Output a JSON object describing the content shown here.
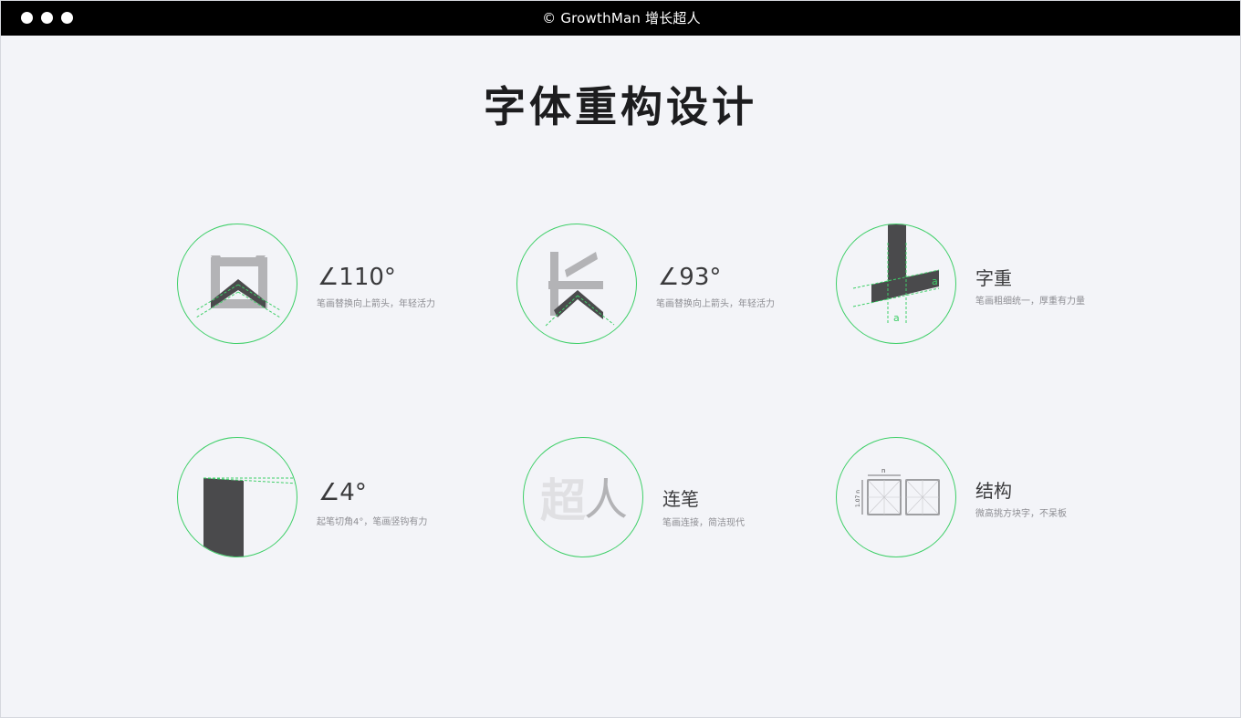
{
  "window": {
    "title": "© GrowthMan 增长超人",
    "controls": [
      "window-dot-1",
      "window-dot-2",
      "window-dot-3"
    ]
  },
  "headline": "字体重构设计",
  "colors": {
    "ring": "#3ecf68",
    "stroke_dark": "#4a4a4c",
    "stroke_light": "#b3b3b6",
    "background": "#f3f4f8"
  },
  "features": [
    {
      "title": "∠110°",
      "desc": "笔画替换向上箭头，年轻活力",
      "icon": "glyph-zeng-arrow"
    },
    {
      "title": "∠93°",
      "desc": "笔画替换向上箭头，年轻活力",
      "icon": "glyph-chang"
    },
    {
      "title": "字重",
      "desc": "笔画粗细统一，厚重有力量",
      "icon": "weight-cross",
      "mark": "a"
    },
    {
      "title": "∠4°",
      "desc": "起笔切角4°，笔画竖钩有力",
      "icon": "cut-corner-stroke"
    },
    {
      "title": "连笔",
      "desc": "笔画连接，简洁现代",
      "icon": "glyph-chaoren",
      "sample": "超人"
    },
    {
      "title": "结构",
      "desc": "微高挑方块字，不呆板",
      "icon": "grid-boxes",
      "mark_top": "n",
      "mark_side": "1.07 n"
    }
  ]
}
